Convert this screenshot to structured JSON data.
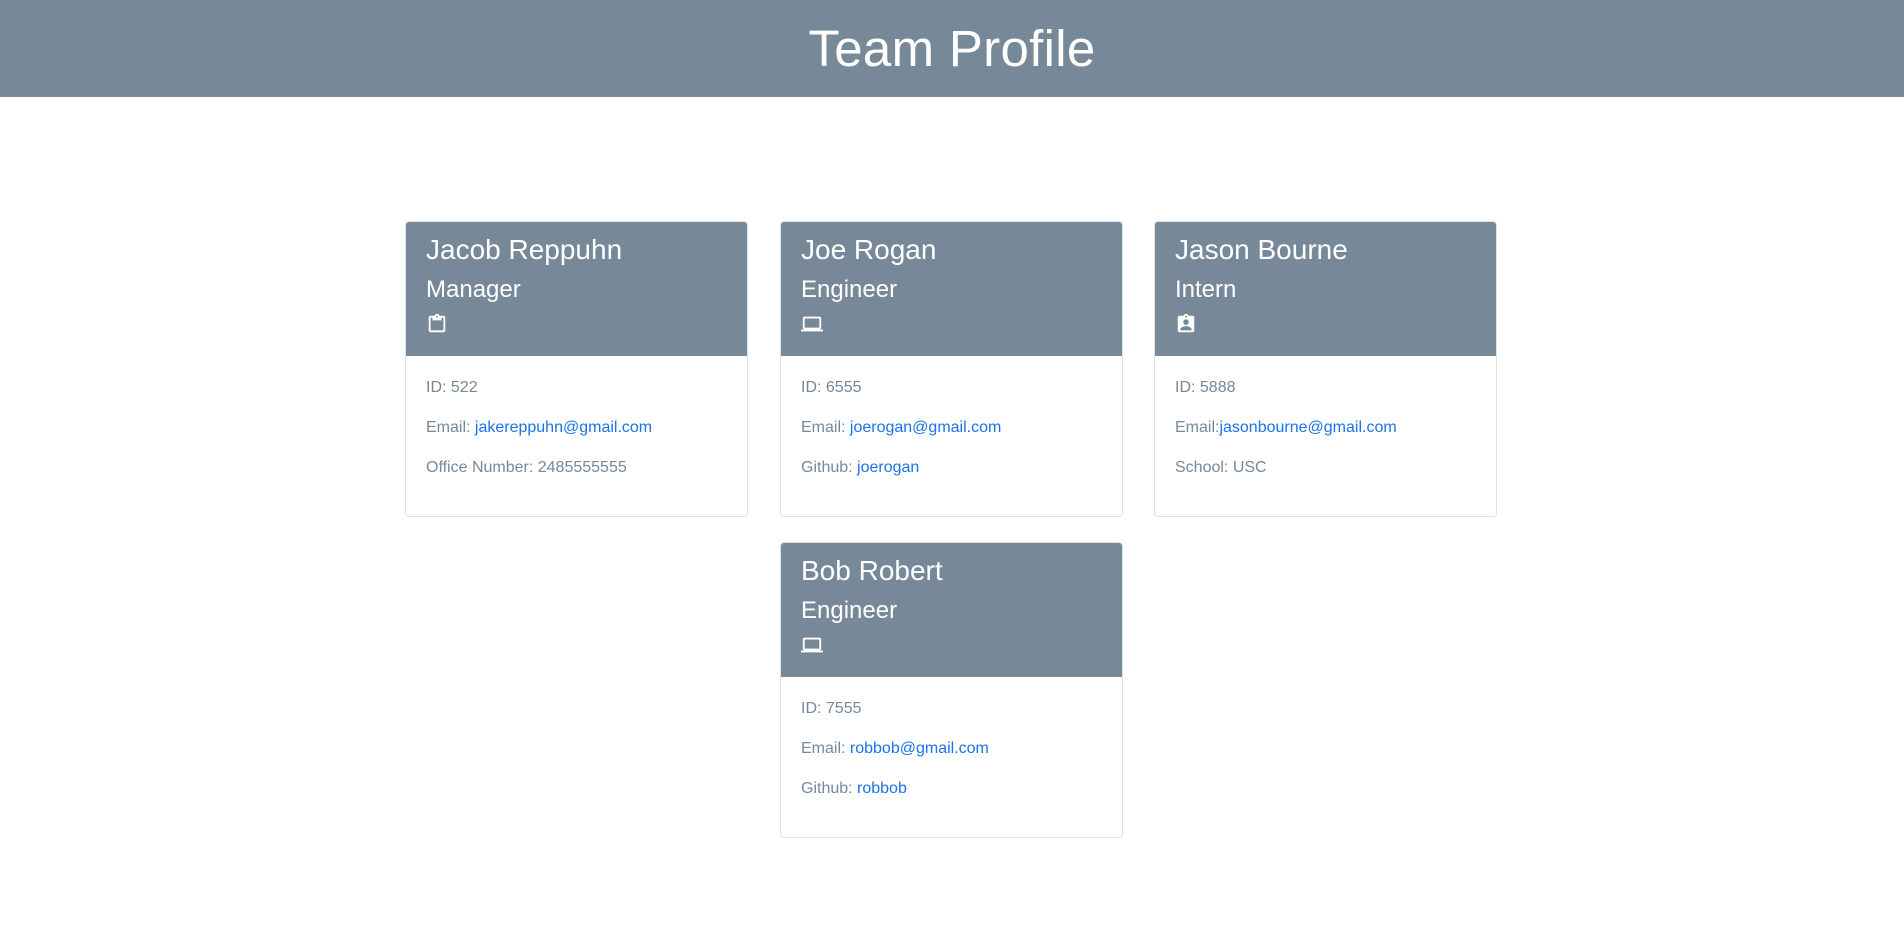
{
  "header": {
    "title": "Team Profile"
  },
  "colors": {
    "accent": "#778899",
    "link": "#1a73e8"
  },
  "cards": [
    {
      "name": "Jacob Reppuhn",
      "role": "Manager",
      "icon": "clipboard-icon",
      "id_label": "ID: ",
      "id": "522",
      "email_label": "Email: ",
      "email": "jakereppuhn@gmail.com",
      "extra_label": "Office Number: ",
      "extra_value": "2485555555"
    },
    {
      "name": "Joe Rogan",
      "role": "Engineer",
      "icon": "laptop-icon",
      "id_label": "ID: ",
      "id": "6555",
      "email_label": "Email: ",
      "email": "joerogan@gmail.com",
      "extra_label": "Github: ",
      "extra_value": "joerogan"
    },
    {
      "name": "Jason Bourne",
      "role": "Intern",
      "icon": "assignment-ind-icon",
      "id_label": "ID: ",
      "id": "5888",
      "email_label": "Email:",
      "email": "jasonbourne@gmail.com",
      "extra_label": "School: ",
      "extra_value": "USC"
    },
    {
      "name": "Bob Robert",
      "role": "Engineer",
      "icon": "laptop-icon",
      "id_label": "ID: ",
      "id": "7555",
      "email_label": "Email: ",
      "email": "robbob@gmail.com",
      "extra_label": "Github: ",
      "extra_value": "robbob"
    }
  ]
}
